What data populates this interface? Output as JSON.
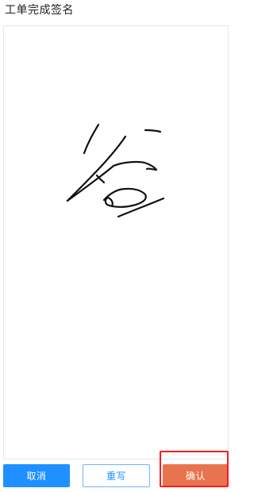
{
  "header": {
    "title": "工单完成签名"
  },
  "actions": {
    "cancel_label": "取消",
    "rewrite_label": "重写",
    "confirm_label": "确认"
  },
  "colors": {
    "primary": "#1e90ff",
    "confirm": "#e8734f",
    "highlight": "#ff1a1a"
  }
}
